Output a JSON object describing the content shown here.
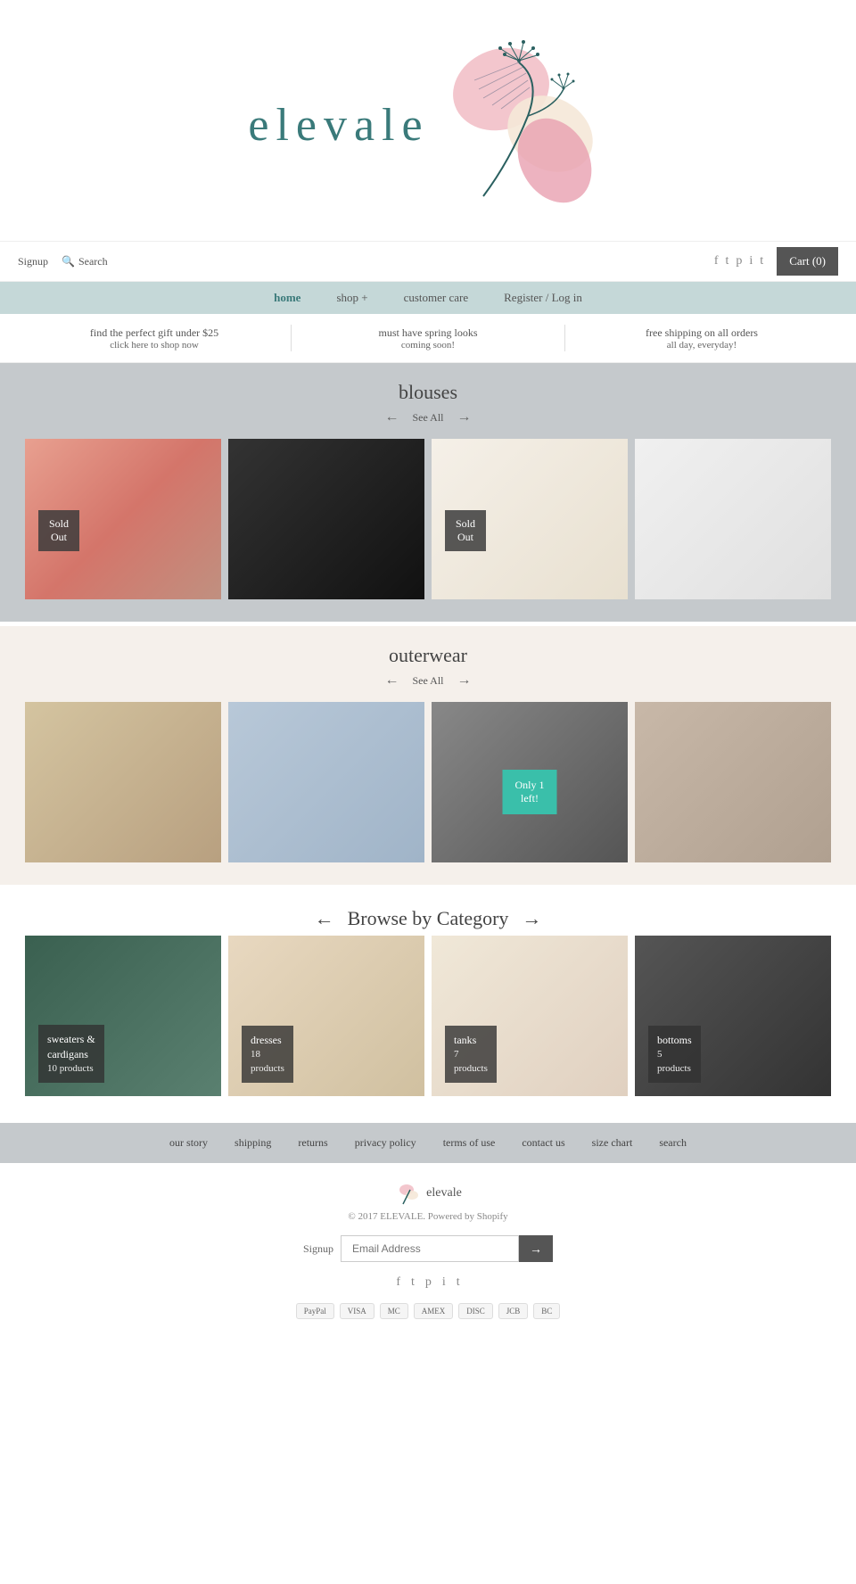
{
  "header": {
    "logo_text": "elevale",
    "signup_label": "Signup",
    "search_label": "Search",
    "cart_label": "Cart",
    "cart_count": "(0)"
  },
  "social": {
    "icons": [
      "f",
      "t",
      "p",
      "i",
      "t2"
    ]
  },
  "nav": {
    "items": [
      {
        "label": "home",
        "active": true
      },
      {
        "label": "shop +",
        "active": false
      },
      {
        "label": "customer care",
        "active": false
      },
      {
        "label": "Register / Log in",
        "active": false
      }
    ]
  },
  "promo": {
    "items": [
      {
        "title": "find the perfect gift under $25",
        "subtitle": "click here to shop now"
      },
      {
        "title": "must have spring looks",
        "subtitle": "coming soon!"
      },
      {
        "title": "free shipping on all orders",
        "subtitle": "all day, everyday!"
      }
    ]
  },
  "blouses": {
    "section_title": "blouses",
    "see_all": "See All",
    "products": [
      {
        "badge": "Sold Out",
        "has_badge": true,
        "badge_type": "sold-out",
        "img_class": "img-p1"
      },
      {
        "badge": "",
        "has_badge": false,
        "img_class": "img-p2"
      },
      {
        "badge": "Sold Out",
        "has_badge": true,
        "badge_type": "sold-out",
        "img_class": "img-p3"
      },
      {
        "badge": "",
        "has_badge": false,
        "img_class": "img-p4"
      }
    ]
  },
  "outerwear": {
    "section_title": "outerwear",
    "see_all": "See All",
    "products": [
      {
        "badge": "",
        "has_badge": false,
        "img_class": "img-o1"
      },
      {
        "badge": "",
        "has_badge": false,
        "img_class": "img-o2"
      },
      {
        "badge": "Only 1 left!",
        "has_badge": true,
        "badge_type": "only-left",
        "img_class": "img-o3"
      },
      {
        "badge": "",
        "has_badge": false,
        "img_class": "img-o4"
      }
    ]
  },
  "browse": {
    "section_title": "Browse by Category",
    "categories": [
      {
        "name": "sweaters &\ncardigans",
        "count": "10 products",
        "img_class": "cat-img-1"
      },
      {
        "name": "dresses",
        "count": "18\nproducts",
        "img_class": "cat-img-2"
      },
      {
        "name": "tanks",
        "count": "7\nproducts",
        "img_class": "cat-img-3"
      },
      {
        "name": "bottoms",
        "count": "5\nproducts",
        "img_class": "cat-img-4"
      }
    ]
  },
  "footer_nav": {
    "links": [
      "our story",
      "shipping",
      "returns",
      "privacy policy",
      "terms of use",
      "contact us",
      "size chart",
      "search"
    ]
  },
  "footer": {
    "copyright": "© 2017 ELEVALE. Powered by Shopify",
    "signup_label": "Signup",
    "email_placeholder": "Email Address",
    "submit_arrow": "→",
    "payment_methods": [
      "PayPal",
      "VISA",
      "MC",
      "AMEX",
      "DISC",
      "JCB",
      "BC"
    ]
  }
}
